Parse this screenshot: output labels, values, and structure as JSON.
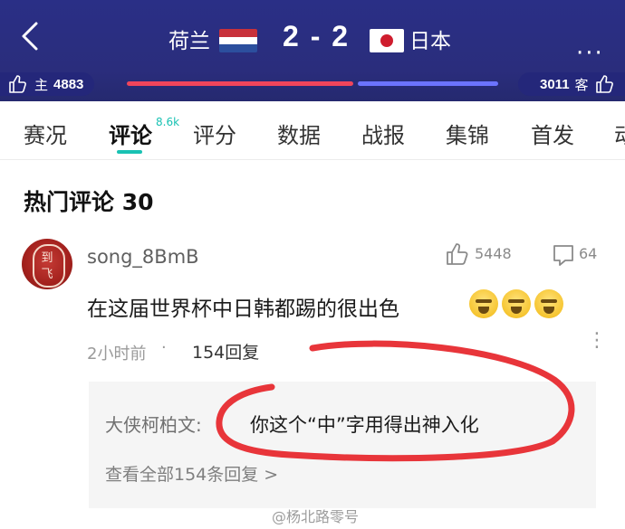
{
  "header": {
    "faint_text": "",
    "team_home": "荷兰",
    "score": "2 - 2",
    "team_away": "日本",
    "more_label": "···",
    "vote": {
      "home_label": "主",
      "home_count": "4883",
      "away_count": "3011",
      "away_label": "客"
    },
    "colors": {
      "bg": "#2a2f86",
      "home_bar": "#f0455b",
      "away_bar": "#6c74ff"
    }
  },
  "tabs": {
    "items": [
      {
        "label": "赛况"
      },
      {
        "label": "评论"
      },
      {
        "label": "评分"
      },
      {
        "label": "数据"
      },
      {
        "label": "战报"
      },
      {
        "label": "集锦"
      },
      {
        "label": "首发"
      },
      {
        "label": "动"
      }
    ],
    "active_badge": "8.6k",
    "accent": "#19c2b3"
  },
  "section": {
    "title": "热门评论 30"
  },
  "comment": {
    "avatar_chars": [
      "到",
      "飞"
    ],
    "username": "song_8BmB",
    "likes": "5448",
    "dislikes": "64",
    "text": "在这届世界杯中日韩都踢的很出色",
    "emoji_icon": "crying-face-icon",
    "time": "2小时前",
    "dot": "·",
    "replies": "154回复",
    "reply": {
      "author": "大侠柯柏文:",
      "text": "你这个“中”字用得出神入化",
      "view_all": "查看全部154条回复 >"
    }
  },
  "watermark": "@杨北路零号"
}
